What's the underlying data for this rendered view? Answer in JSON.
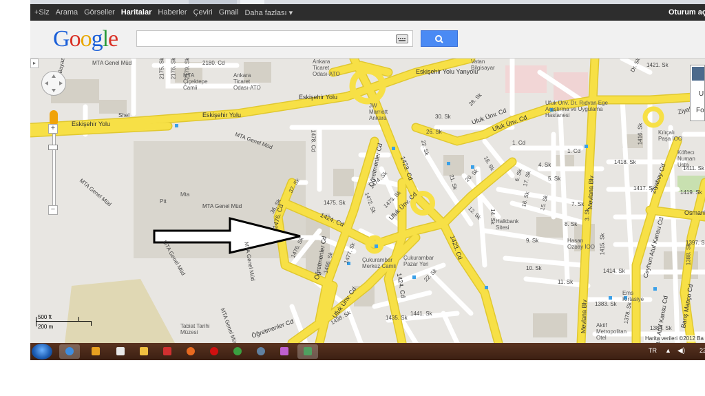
{
  "gbar": {
    "items": [
      "+Siz",
      "Arama",
      "Görseller",
      "Haritalar",
      "Haberler",
      "Çeviri",
      "Gmail",
      "Daha fazlası ▾"
    ],
    "active_index": 3,
    "signin": "Oturum aç"
  },
  "header": {
    "logo": [
      "G",
      "o",
      "o",
      "g",
      "l",
      "e"
    ],
    "search_value": "",
    "keyboard_icon": "keyboard-icon",
    "search_icon": "magnifier-icon"
  },
  "controls": {
    "collapse_icon": "▸",
    "zoom_in": "+",
    "zoom_out": "−"
  },
  "scale": {
    "top": "500 ft",
    "bottom": "200 m"
  },
  "attribution": "Harita verileri ©2012 Ba",
  "map_type_box": {
    "l1": "U",
    "l2": "Fo"
  },
  "streets": [
    "Eskişehir Yolu",
    "Eskişehir Yolu",
    "Eskişehir Yolu",
    "Eskişehir Yolu Yanyolu",
    "Öğretmenler Cd",
    "Öğretmenler Cd",
    "Öğretmenler Cd",
    "1423. Cd",
    "1423. Cd",
    "1424. Cd",
    "1424. Cd",
    "1476. Cd",
    "1478. Cd",
    "Ufuk Ünv. Cd",
    "Ufuk Ünv. Cd",
    "Ufuk Ünv. Cd",
    "Ufuk Ünv. Cd",
    "Mevlana Blv",
    "Mevlana Blv",
    "Ceyhun Atuf Kansu Cd",
    "Ceyhun Atuf Kansu Cd",
    "Barış Manço Cd",
    "Ziyabey Cd",
    "Ziyabey Cd",
    "Osmanl",
    "2180. Cd",
    "2175. Sk",
    "2176. Sk",
    "2179. Sk",
    "28. Sk",
    "30. Sk",
    "26. Sk",
    "22. Sk",
    "21. Sk",
    "20. Sk",
    "18. Sk",
    "17. Sk",
    "16. Sk",
    "15. Sk",
    "14. Sk",
    "12. Sk",
    "9. Sk",
    "8. Sk",
    "7. Sk",
    "4. Sk",
    "5. Sk",
    "3. Sk",
    "1. Cd",
    "1. Cd",
    "10. Sk",
    "11. Sk",
    "6. Sk",
    "37. Sk",
    "36. Sk",
    "1476. Sk",
    "1475. Sk",
    "1474. Sk",
    "1473. Sk",
    "1472. Sk",
    "1477. Sk",
    "1466. Sk",
    "1438. Sk",
    "1435. Sk",
    "1441. Sk",
    "1418. Sk",
    "1417. Sk",
    "1411. Sk",
    "1414. Sk",
    "1415. Sk",
    "1416. Sk",
    "1383. Sk",
    "1378. Sk",
    "1384. Sk",
    "1388. Sk",
    "1397. Sk",
    "1419. Sk",
    "Dr. Sk",
    "1421. Sk",
    "22. Sk",
    "Bayaz",
    "MTA Genel Müd",
    "MTA Genel Müd",
    "MTA Genel Müd",
    "MTA Genel Müd",
    "MTA Genel Müd",
    "MTA Genel Müd",
    "MTA Genel Müd",
    "Shel"
  ],
  "pois": [
    "MTA Çiçektepe Camii",
    "Ankara Ticaret Odası-ATO",
    "Ankara Ticaret Odası-ATO",
    "JW Marriott Ankara",
    "Vatan Bilgisayar",
    "Ufuk Ünv. Dr. Rıdvan Ege Araştırma ve Uygulama Hastanesi",
    "Kılıçalı Paşa İOO",
    "Köftecı Numan Usta",
    "Halkbank Sitesi",
    "Hasan Özbay İOO",
    "Çukurambar Merkez Camii",
    "Çukurambar Pazar Yeri",
    "Ems Kırtasiye",
    "Aktif Metropolitan Otel",
    "Tabiat Tarihi Müzesi",
    "Mta",
    "Ptt"
  ],
  "taskbar": {
    "apps": [
      "ie-icon",
      "media-icon",
      "calendar-icon",
      "folder-icon",
      "office-icon",
      "firefox-icon",
      "opera-icon",
      "chrome-icon",
      "globe-icon",
      "paint-icon",
      "maps-icon"
    ],
    "lang": "TR",
    "clock": "22"
  },
  "colors": {
    "road_major": "#f7e046",
    "road_minor": "#ffffff",
    "park": "#c8e0b0",
    "map_bg": "#e8e6e2",
    "building": "#d6d2c8"
  }
}
